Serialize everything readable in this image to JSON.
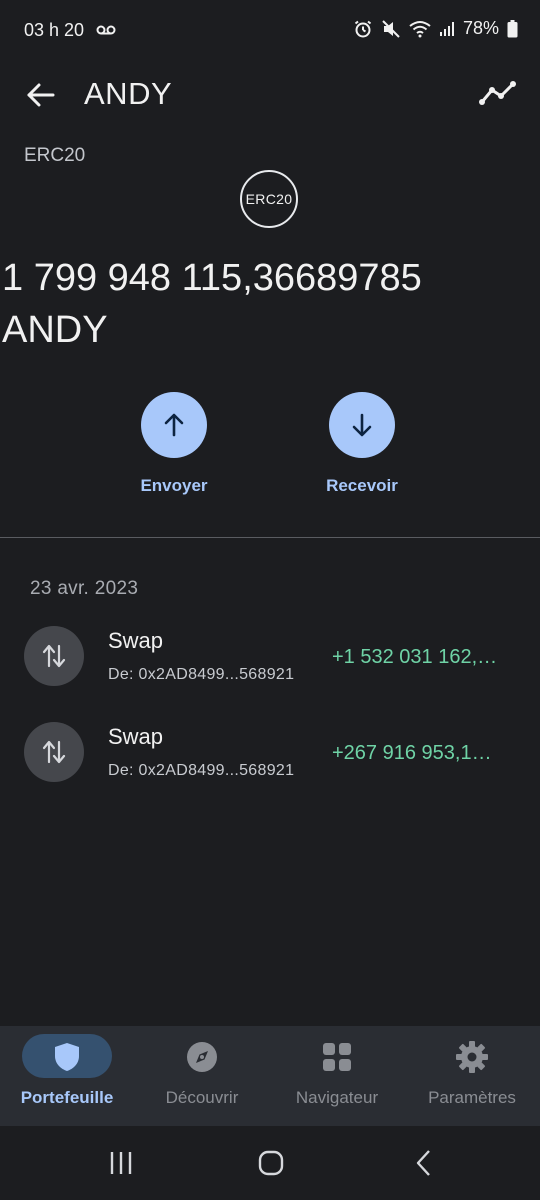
{
  "status_bar": {
    "time": "03 h 20",
    "battery": "78%",
    "icons": [
      "voicemail-icon",
      "alarm-icon",
      "mute-icon",
      "wifi-icon",
      "signal-icon",
      "battery-icon"
    ]
  },
  "header": {
    "title": "ANDY",
    "back_icon": "arrow-left-icon",
    "chart_icon": "trend-line-icon"
  },
  "token": {
    "network": "ERC20",
    "logo_text": "ERC20",
    "balance": "1 799 948 115,36689785",
    "symbol": "ANDY"
  },
  "actions": {
    "send_label": "Envoyer",
    "receive_label": "Recevoir"
  },
  "transactions": {
    "date": "23 avr. 2023",
    "items": [
      {
        "title": "Swap",
        "from": "De: 0x2AD8499...568921",
        "amount": "+1 532 031 162,…"
      },
      {
        "title": "Swap",
        "from": "De: 0x2AD8499...568921",
        "amount": "+267 916 953,1…"
      }
    ]
  },
  "bottom_nav": {
    "items": [
      {
        "label": "Portefeuille",
        "icon": "shield-icon",
        "active": true
      },
      {
        "label": "Découvrir",
        "icon": "compass-icon",
        "active": false
      },
      {
        "label": "Navigateur",
        "icon": "grid-icon",
        "active": false
      },
      {
        "label": "Paramètres",
        "icon": "gear-icon",
        "active": false
      }
    ]
  },
  "colors": {
    "background": "#1c1d20",
    "accent": "#a8c8fa",
    "positive": "#6fd3a6",
    "nav_background": "#2a2d33"
  }
}
